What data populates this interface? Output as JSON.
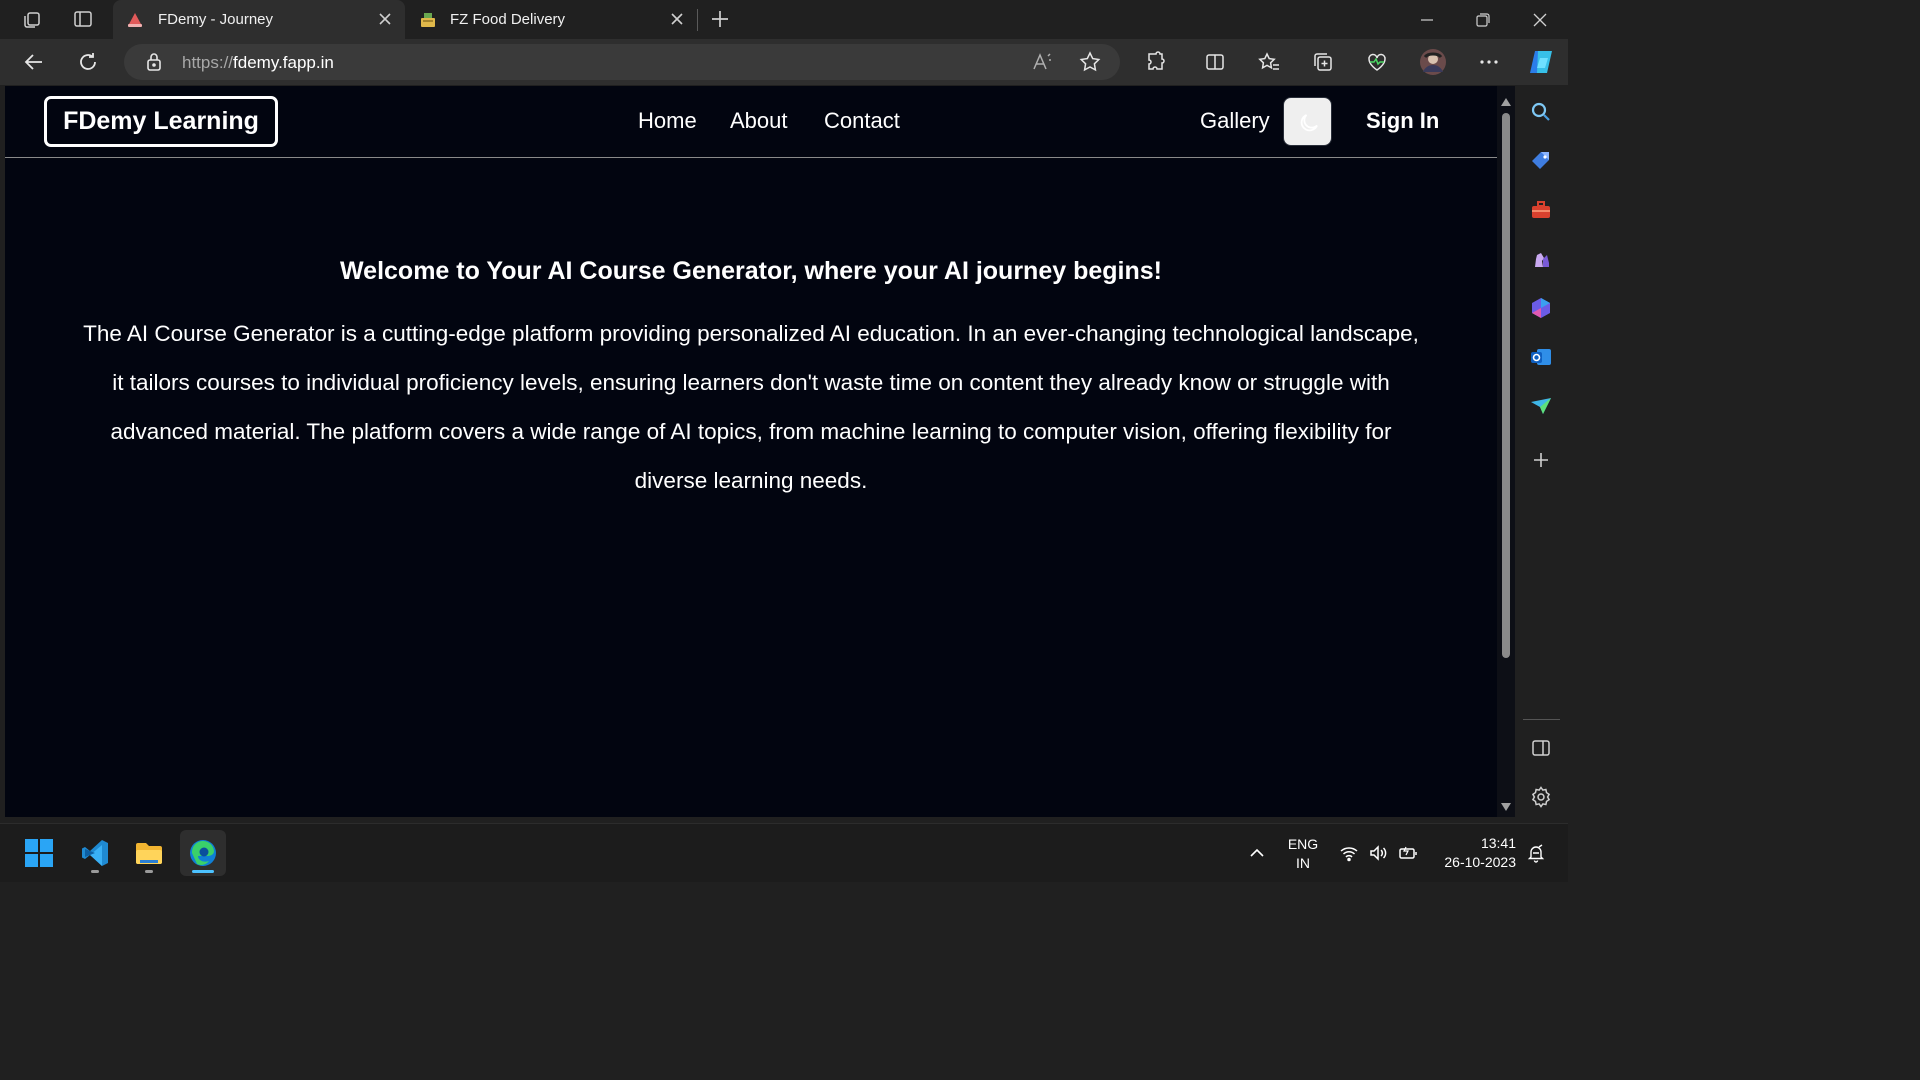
{
  "browser": {
    "tabs": [
      {
        "title": "FDemy - Journey",
        "active": true
      },
      {
        "title": "FZ Food Delivery",
        "active": false
      }
    ],
    "address": {
      "scheme": "https://",
      "host": "fdemy.fapp.in"
    }
  },
  "site": {
    "brand": "FDemy Learning",
    "nav": {
      "home": "Home",
      "about": "About",
      "contact": "Contact",
      "gallery": "Gallery",
      "sign_in": "Sign In"
    },
    "hero": {
      "title": "Welcome to Your AI Course Generator, where your AI journey begins!",
      "body": "The AI Course Generator is a cutting-edge platform providing personalized AI education. In an ever-changing technological landscape, it tailors courses to individual proficiency levels, ensuring learners don't waste time on content they already know or struggle with advanced material. The platform covers a wide range of AI topics, from machine learning to computer vision, offering flexibility for diverse learning needs."
    }
  },
  "taskbar": {
    "lang_top": "ENG",
    "lang_bottom": "IN",
    "time": "13:41",
    "date": "26-10-2023"
  },
  "colors": {
    "page_bg": "#020510",
    "browser_chrome": "#2e2e2e",
    "accent": "#4cc2ff"
  }
}
